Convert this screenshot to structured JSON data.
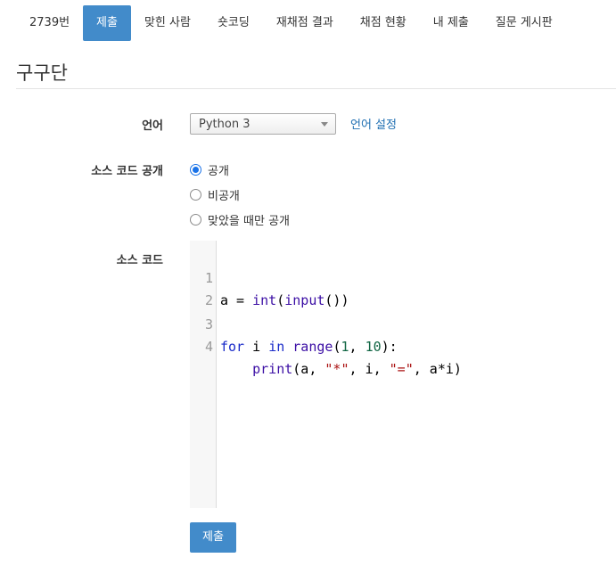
{
  "nav": {
    "items": [
      {
        "label": "2739번"
      },
      {
        "label": "제출"
      },
      {
        "label": "맞힌 사람"
      },
      {
        "label": "숏코딩"
      },
      {
        "label": "재채점 결과"
      },
      {
        "label": "채점 현황"
      },
      {
        "label": "내 제출"
      },
      {
        "label": "질문 게시판"
      }
    ],
    "active_index": 1
  },
  "page": {
    "title": "구구단"
  },
  "form": {
    "language_label": "언어",
    "language_value": "Python 3",
    "language_settings_link": "언어 설정",
    "visibility_label": "소스 코드 공개",
    "visibility_options": [
      {
        "label": "공개",
        "selected": true
      },
      {
        "label": "비공개",
        "selected": false
      },
      {
        "label": "맞았을 때만 공개",
        "selected": false
      }
    ],
    "source_label": "소스 코드",
    "submit_label": "제출"
  },
  "editor": {
    "line_numbers": [
      "1",
      "2",
      "3",
      "4"
    ],
    "lines": [
      "a = int(input())",
      "",
      "for i in range(1, 10):",
      "    print(a, \"*\", i, \"=\", a*i)"
    ]
  },
  "colors": {
    "accent": "#428bca",
    "link": "#1f6fb2",
    "keyword": "#1a2bc9",
    "string": "#aa1111",
    "number": "#116644"
  }
}
